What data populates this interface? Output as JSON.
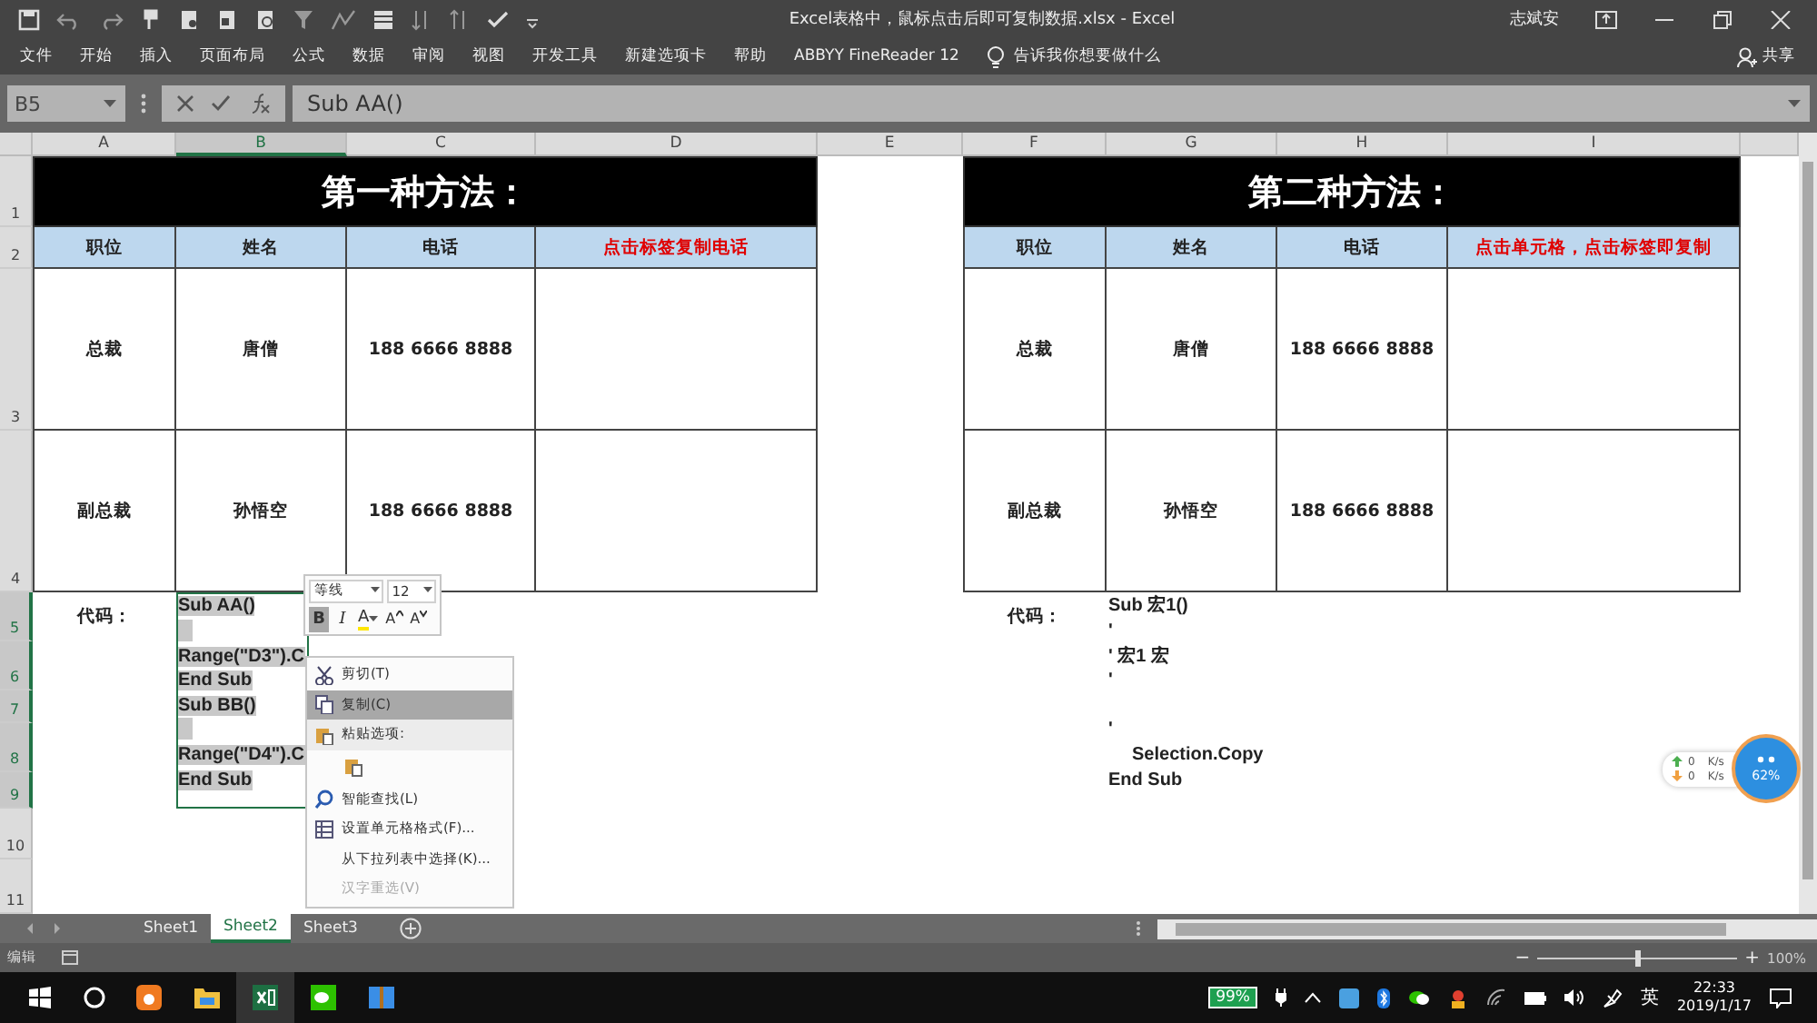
{
  "window": {
    "title": "Excel表格中，鼠标点击后即可复制数据.xlsx  -  Excel",
    "user": "志斌安"
  },
  "ribbon_tabs": [
    "文件",
    "开始",
    "插入",
    "页面布局",
    "公式",
    "数据",
    "审阅",
    "视图",
    "开发工具",
    "新建选项卡",
    "帮助",
    "ABBYY FineReader 12"
  ],
  "tell_me": "告诉我你想要做什么",
  "share": "共享",
  "formula_bar": {
    "name_box": "B5",
    "formula": "Sub AA()"
  },
  "columns": [
    {
      "label": "A",
      "selected": false
    },
    {
      "label": "B",
      "selected": true
    },
    {
      "label": "C",
      "selected": false
    },
    {
      "label": "D",
      "selected": false
    },
    {
      "label": "E",
      "selected": false
    },
    {
      "label": "F",
      "selected": false
    },
    {
      "label": "G",
      "selected": false
    },
    {
      "label": "H",
      "selected": false
    },
    {
      "label": "I",
      "selected": false
    }
  ],
  "rows": [
    {
      "label": "1",
      "selected": false
    },
    {
      "label": "2",
      "selected": false
    },
    {
      "label": "3",
      "selected": false
    },
    {
      "label": "4",
      "selected": false
    },
    {
      "label": "5",
      "selected": true
    },
    {
      "label": "6",
      "selected": true
    },
    {
      "label": "7",
      "selected": true
    },
    {
      "label": "8",
      "selected": true
    },
    {
      "label": "9",
      "selected": true
    },
    {
      "label": "10",
      "selected": false
    },
    {
      "label": "11",
      "selected": false
    }
  ],
  "sections": [
    {
      "title": "第一种方法：",
      "headers": [
        "职位",
        "姓名",
        "电话",
        "点击标签复制电话"
      ],
      "data": [
        [
          "总裁",
          "唐僧",
          "188 6666 8888"
        ],
        [
          "副总裁",
          "孙悟空",
          "188 6666 8888"
        ]
      ],
      "code_label": "代码：",
      "code": {
        "selected": true,
        "lines": [
          {
            "kind": "line",
            "text": "Sub AA()"
          },
          {
            "kind": "blank"
          },
          {
            "kind": "line",
            "text": "Range(\"D3\").C"
          },
          {
            "kind": "line",
            "text": "End Sub"
          },
          {
            "kind": "line",
            "text": "Sub BB()"
          },
          {
            "kind": "blank"
          },
          {
            "kind": "line",
            "text": "Range(\"D4\").C"
          },
          {
            "kind": "line",
            "text": "End Sub"
          }
        ]
      }
    },
    {
      "title": "第二种方法：",
      "headers": [
        "职位",
        "姓名",
        "电话",
        "点击单元格，点击标签即复制"
      ],
      "data": [
        [
          "总裁",
          "唐僧",
          "188 6666 8888"
        ],
        [
          "副总裁",
          "孙悟空",
          "188 6666 8888"
        ]
      ],
      "code_label": "代码：",
      "code": {
        "selected": false,
        "lines": [
          {
            "kind": "line",
            "text": "Sub 宏1()"
          },
          {
            "kind": "line",
            "text": "'"
          },
          {
            "kind": "line",
            "text": "' 宏1 宏"
          },
          {
            "kind": "line",
            "text": "'"
          },
          {
            "kind": "blank"
          },
          {
            "kind": "line",
            "text": "'"
          },
          {
            "kind": "indented",
            "text": "Selection.Copy"
          },
          {
            "kind": "line",
            "text": "End Sub"
          }
        ]
      }
    }
  ],
  "mini_toolbar": {
    "font": "等线",
    "size": "12",
    "buttons": [
      {
        "kind": "bold",
        "label": "B",
        "on": true
      },
      {
        "kind": "italic",
        "label": "I",
        "on": false
      },
      {
        "kind": "font-color",
        "label": "A",
        "on": false
      },
      {
        "kind": "grow",
        "label": "A",
        "on": false
      },
      {
        "kind": "shrink",
        "label": "A",
        "on": false
      }
    ]
  },
  "context_menu": [
    {
      "kind": "cut",
      "label": "剪切(T)",
      "selected": false,
      "disabled": false
    },
    {
      "kind": "copy",
      "label": "复制(C)",
      "selected": true,
      "disabled": false
    },
    {
      "kind": "paste-header",
      "label": "粘贴选项:",
      "selected": false,
      "disabled": false
    },
    {
      "kind": "paste-option",
      "selected": false,
      "disabled": false
    },
    {
      "kind": "lookup",
      "label": "智能查找(L)",
      "selected": false,
      "disabled": false
    },
    {
      "kind": "format",
      "label": "设置单元格格式(F)...",
      "selected": false,
      "disabled": false
    },
    {
      "kind": "plain",
      "label": "从下拉列表中选择(K)...",
      "selected": false,
      "disabled": false
    },
    {
      "kind": "plain",
      "label": "汉字重选(V)",
      "selected": false,
      "disabled": true
    }
  ],
  "sheet_tabs": [
    {
      "label": "Sheet1",
      "selected": false
    },
    {
      "label": "Sheet2",
      "selected": true
    },
    {
      "label": "Sheet3",
      "selected": false
    }
  ],
  "status_bar": {
    "mode": "编辑",
    "zoom_out": "−",
    "zoom_slider": {
      "level": 0.5
    },
    "zoom_in": "+",
    "zoom": "100%"
  },
  "net_widget": {
    "upload": "0",
    "upload_unit": "K/s",
    "download": "0",
    "download_unit": "K/s",
    "percent": "62%"
  },
  "taskbar": {
    "battery": "99%",
    "ime": "英",
    "time": "22:33",
    "date": "2019/1/17"
  }
}
